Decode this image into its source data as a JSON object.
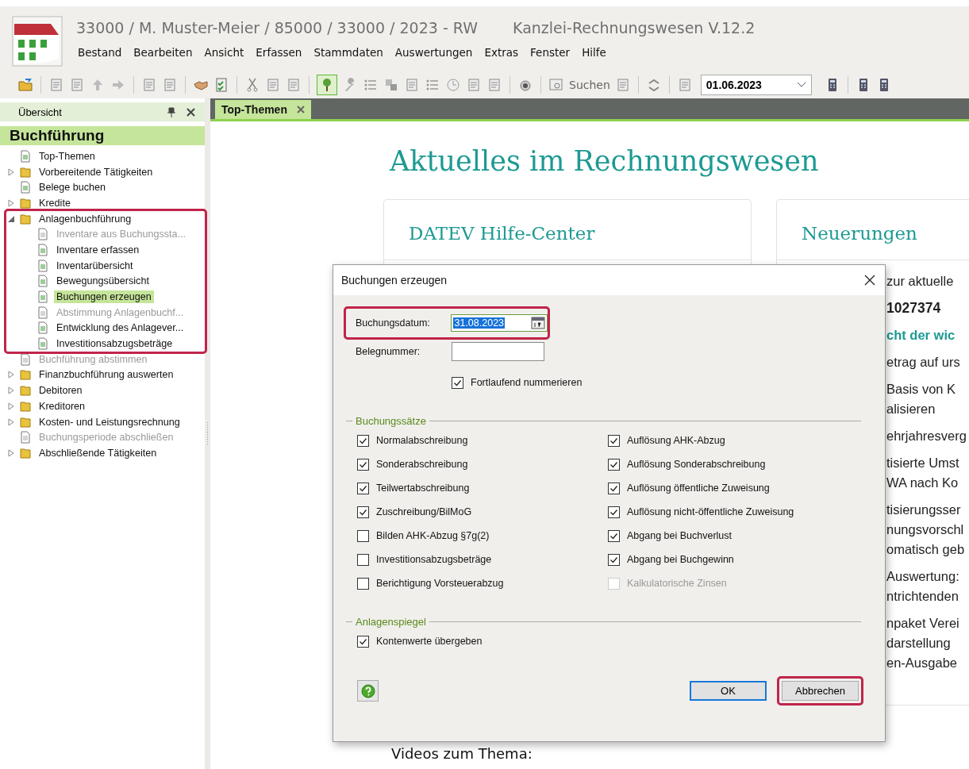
{
  "window": {
    "title": "33000 / M. Muster-Meier / 85000 / 33000 / 2023 - RW",
    "app_name": "Kanzlei-Rechnungswesen V.12.2"
  },
  "menu": [
    "Bestand",
    "Bearbeiten",
    "Ansicht",
    "Erfassen",
    "Stammdaten",
    "Auswertungen",
    "Extras",
    "Fenster",
    "Hilfe"
  ],
  "toolbar": {
    "tree_toggle_on": true,
    "search_label": "Suchen",
    "date": "01.06.2023"
  },
  "sidebar": {
    "title": "Übersicht",
    "section": "Buchführung",
    "items": [
      {
        "label": "Top-Themen",
        "kind": "doc",
        "disabled": false,
        "selected": false
      },
      {
        "label": "Vorbereitende Tätigkeiten",
        "kind": "folder",
        "expanded": false,
        "disabled": false,
        "selected": false
      },
      {
        "label": "Belege buchen",
        "kind": "doc",
        "disabled": false,
        "selected": false
      },
      {
        "label": "Kredite",
        "kind": "folder",
        "expanded": false,
        "disabled": false,
        "selected": false
      },
      {
        "label": "Anlagenbuchführung",
        "kind": "folder",
        "expanded": true,
        "disabled": false,
        "selected": false,
        "highlighted": true,
        "children": [
          {
            "label": "Inventare aus Buchungssta...",
            "kind": "doc",
            "disabled": true,
            "selected": false
          },
          {
            "label": "Inventare erfassen",
            "kind": "doc",
            "disabled": false,
            "selected": false
          },
          {
            "label": "Inventarübersicht",
            "kind": "doc",
            "disabled": false,
            "selected": false
          },
          {
            "label": "Bewegungsübersicht",
            "kind": "doc",
            "disabled": false,
            "selected": false
          },
          {
            "label": "Buchungen erzeugen",
            "kind": "doc",
            "disabled": false,
            "selected": true
          },
          {
            "label": "Abstimmung Anlagenbuchf...",
            "kind": "doc",
            "disabled": true,
            "selected": false
          },
          {
            "label": "Entwicklung des Anlagever...",
            "kind": "doc",
            "disabled": false,
            "selected": false
          },
          {
            "label": "Investitionsabzugsbeträge",
            "kind": "doc",
            "disabled": false,
            "selected": false
          }
        ]
      },
      {
        "label": "Buchführung abstimmen",
        "kind": "doc",
        "disabled": true,
        "selected": false
      },
      {
        "label": "Finanzbuchführung auswerten",
        "kind": "folder",
        "expanded": false,
        "disabled": false,
        "selected": false
      },
      {
        "label": "Debitoren",
        "kind": "folder",
        "expanded": false,
        "disabled": false,
        "selected": false
      },
      {
        "label": "Kreditoren",
        "kind": "folder",
        "expanded": false,
        "disabled": false,
        "selected": false
      },
      {
        "label": "Kosten- und Leistungsrechnung",
        "kind": "folder",
        "expanded": false,
        "disabled": false,
        "selected": false
      },
      {
        "label": "Buchungsperiode abschließen",
        "kind": "doc",
        "disabled": true,
        "selected": false
      },
      {
        "label": "Abschließende Tätigkeiten",
        "kind": "folder",
        "expanded": false,
        "disabled": false,
        "selected": false
      }
    ]
  },
  "tabs": [
    {
      "label": "Top-Themen",
      "selected": true
    }
  ],
  "content": {
    "heading": "Aktuelles im Rechnungswesen",
    "cards": [
      {
        "title": "DATEV Hilfe-Center"
      },
      {
        "title": "Neuerungen",
        "paragraphs": [
          {
            "kind": "plain",
            "lines": [
              "zur aktuelle"
            ]
          },
          {
            "kind": "number",
            "lines": [
              "1027374"
            ]
          },
          {
            "kind": "link",
            "lines": [
              "cht der wic"
            ]
          },
          {
            "kind": "plain",
            "lines": [
              "etrag auf urs"
            ]
          },
          {
            "kind": "plain",
            "lines": [
              "Basis von K",
              "alisieren"
            ]
          },
          {
            "kind": "plain",
            "lines": [
              "ehrjahresverg"
            ]
          },
          {
            "kind": "plain",
            "lines": [
              "tisierte Umst",
              "WA nach Ko"
            ]
          },
          {
            "kind": "plain",
            "lines": [
              "tisierungsser",
              "nungsvorschl",
              "omatisch geb"
            ]
          },
          {
            "kind": "plain",
            "lines": [
              "Auswertung:",
              "ntrichtenden"
            ]
          },
          {
            "kind": "plain",
            "lines": [
              "npaket Verei",
              "darstellung",
              "en-Ausgabe"
            ]
          }
        ]
      }
    ],
    "footer": "Videos zum Thema:"
  },
  "dialog": {
    "title": "Buchungen erzeugen",
    "date_label": "Buchungsdatum:",
    "date_value": "31.08.2023",
    "date_selected": true,
    "date_highlighted": true,
    "number_label": "Belegnummer:",
    "consecutive": {
      "label": "Fortlaufend nummerieren",
      "checked": true,
      "disabled": false
    },
    "groups": [
      {
        "title": "Buchungssätze",
        "options": [
          {
            "label": "Normalabschreibung",
            "checked": true,
            "disabled": false
          },
          {
            "label": "Sonderabschreibung",
            "checked": true,
            "disabled": false
          },
          {
            "label": "Teilwertabschreibung",
            "checked": true,
            "disabled": false
          },
          {
            "label": "Zuschreibung/BilMoG",
            "checked": true,
            "disabled": false
          },
          {
            "label": "Bilden AHK-Abzug §7g(2)",
            "checked": false,
            "disabled": false
          },
          {
            "label": "Investitionsabzugsbeträge",
            "checked": false,
            "disabled": false
          },
          {
            "label": "Berichtigung Vorsteuerabzug",
            "checked": false,
            "disabled": false
          },
          {
            "label": "Auflösung AHK-Abzug",
            "checked": true,
            "disabled": false
          },
          {
            "label": "Auflösung Sonderabschreibung",
            "checked": true,
            "disabled": false
          },
          {
            "label": "Auflösung öffentliche Zuweisung",
            "checked": true,
            "disabled": false
          },
          {
            "label": "Auflösung nicht-öffentliche Zuweisung",
            "checked": true,
            "disabled": false
          },
          {
            "label": "Abgang bei Buchverlust",
            "checked": true,
            "disabled": false
          },
          {
            "label": "Abgang bei Buchgewinn",
            "checked": true,
            "disabled": false
          },
          {
            "label": "Kalkulatorische Zinsen",
            "checked": false,
            "disabled": true
          }
        ]
      },
      {
        "title": "Anlagenspiegel",
        "options": [
          {
            "label": "Kontenwerte übergeben",
            "checked": true,
            "disabled": false
          }
        ]
      }
    ],
    "buttons": [
      {
        "label": "OK",
        "kind": "default",
        "highlighted": false
      },
      {
        "label": "Abbrechen",
        "kind": "cancel",
        "highlighted": true
      }
    ]
  }
}
